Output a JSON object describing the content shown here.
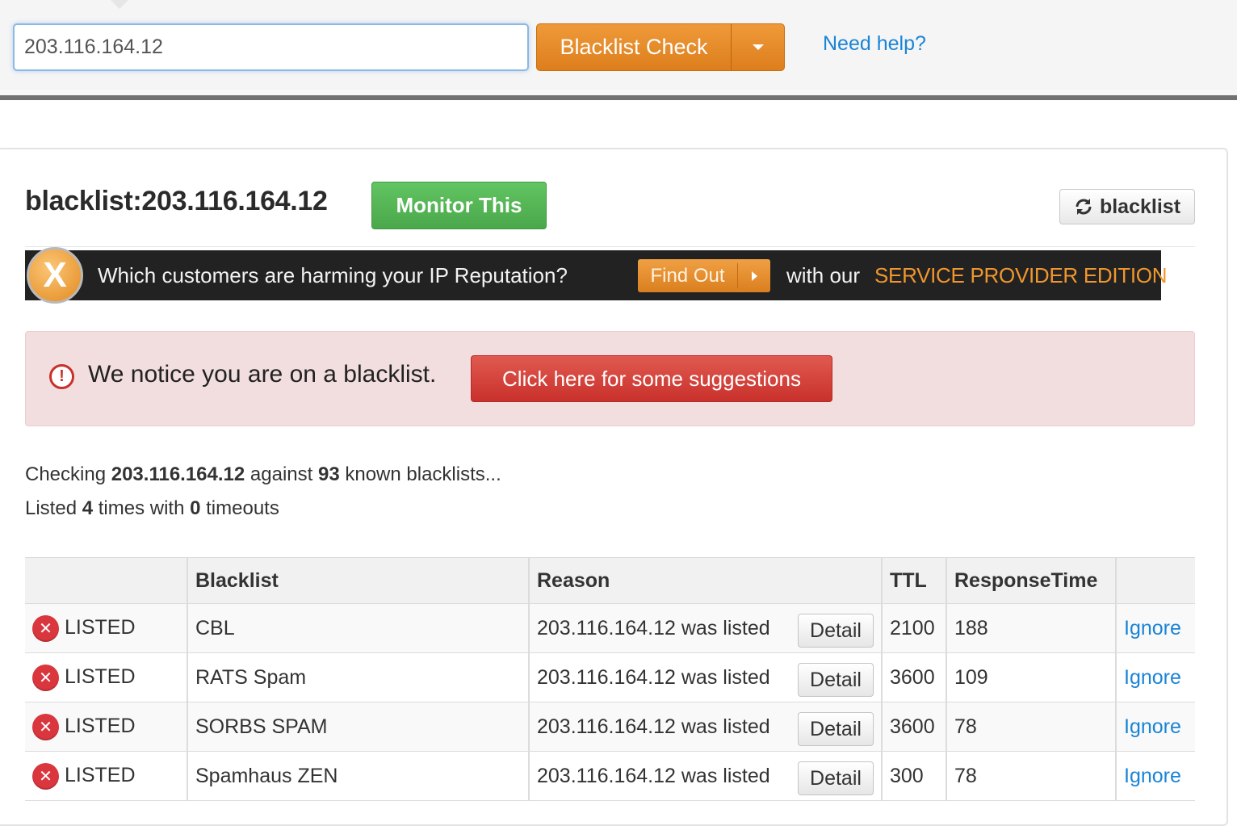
{
  "search": {
    "ip_value": "203.116.164.12",
    "check_button": "Blacklist Check",
    "help_link": "Need help?"
  },
  "header": {
    "title": "blacklist:203.116.164.12",
    "monitor_button": "Monitor This",
    "refresh_button": "blacklist"
  },
  "banner": {
    "logo_letter": "X",
    "question": "Which customers are harming your IP Reputation?",
    "find_out": "Find Out",
    "with_our": "with our",
    "edition": "SERVICE PROVIDER EDITION"
  },
  "alert": {
    "icon_glyph": "!",
    "message": "We notice you are on a blacklist.",
    "suggest_button": "Click here for some suggestions"
  },
  "summary": {
    "checking_prefix": "Checking",
    "ip": "203.116.164.12",
    "against": "against",
    "count": "93",
    "known": "known blacklists...",
    "listed_prefix": "Listed",
    "listed_count": "4",
    "times_with": "times with",
    "timeouts_count": "0",
    "timeouts": "timeouts"
  },
  "table": {
    "headers": [
      "",
      "Blacklist",
      "Reason",
      "TTL",
      "ResponseTime",
      ""
    ],
    "rows": [
      {
        "status": "LISTED",
        "blacklist": "CBL",
        "reason": "203.116.164.12 was listed",
        "detail": "Detail",
        "ttl": "2100",
        "response": "188",
        "action": "Ignore"
      },
      {
        "status": "LISTED",
        "blacklist": "RATS Spam",
        "reason": "203.116.164.12 was listed",
        "detail": "Detail",
        "ttl": "3600",
        "response": "109",
        "action": "Ignore"
      },
      {
        "status": "LISTED",
        "blacklist": "SORBS SPAM",
        "reason": "203.116.164.12 was listed",
        "detail": "Detail",
        "ttl": "3600",
        "response": "78",
        "action": "Ignore"
      },
      {
        "status": "LISTED",
        "blacklist": "Spamhaus ZEN",
        "reason": "203.116.164.12 was listed",
        "detail": "Detail",
        "ttl": "300",
        "response": "78",
        "action": "Ignore"
      }
    ]
  },
  "colors": {
    "orange_accent": "#e68a2a",
    "green_button": "#55b555",
    "red_button": "#d43f3a",
    "alert_background": "#f2dede",
    "link_blue": "#1a84d6"
  }
}
